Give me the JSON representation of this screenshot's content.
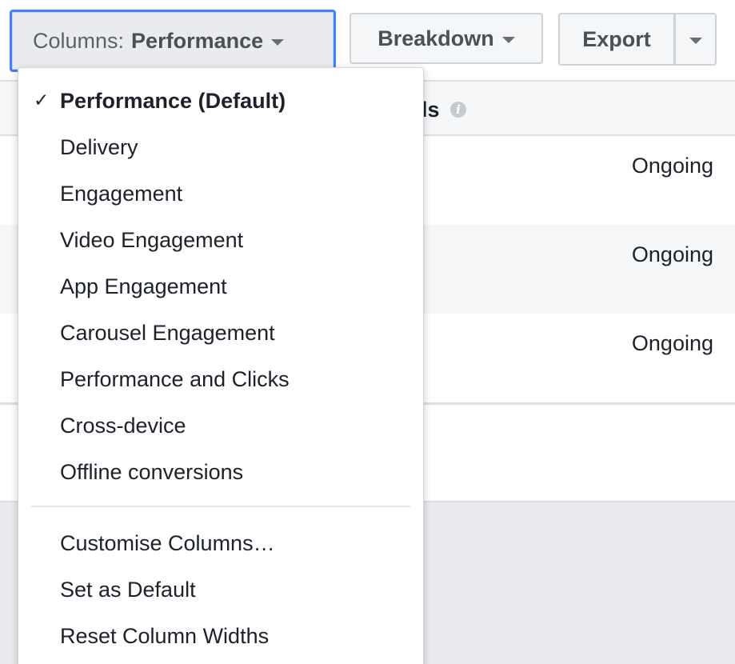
{
  "toolbar": {
    "columns_prefix": "Columns:",
    "columns_value": "Performance",
    "breakdown_label": "Breakdown",
    "export_label": "Export"
  },
  "table": {
    "header_label": "ls",
    "rows": [
      {
        "status": "Ongoing"
      },
      {
        "status": "Ongoing"
      },
      {
        "status": "Ongoing"
      }
    ]
  },
  "menu": {
    "presets": [
      {
        "label": "Performance (Default)",
        "selected": true
      },
      {
        "label": "Delivery",
        "selected": false
      },
      {
        "label": "Engagement",
        "selected": false
      },
      {
        "label": "Video Engagement",
        "selected": false
      },
      {
        "label": "App Engagement",
        "selected": false
      },
      {
        "label": "Carousel Engagement",
        "selected": false
      },
      {
        "label": "Performance and Clicks",
        "selected": false
      },
      {
        "label": "Cross-device",
        "selected": false
      },
      {
        "label": "Offline conversions",
        "selected": false
      }
    ],
    "actions": [
      {
        "label": "Customise Columns…"
      },
      {
        "label": "Set as Default"
      },
      {
        "label": "Reset Column Widths"
      }
    ],
    "check_glyph": "✓"
  },
  "colors": {
    "accent": "#4080ff",
    "text": "#1d2129",
    "button_bg": "#f5f6f7"
  },
  "icons": {
    "info": "info-icon",
    "caret": "caret-down-icon",
    "check": "checkmark-icon"
  }
}
